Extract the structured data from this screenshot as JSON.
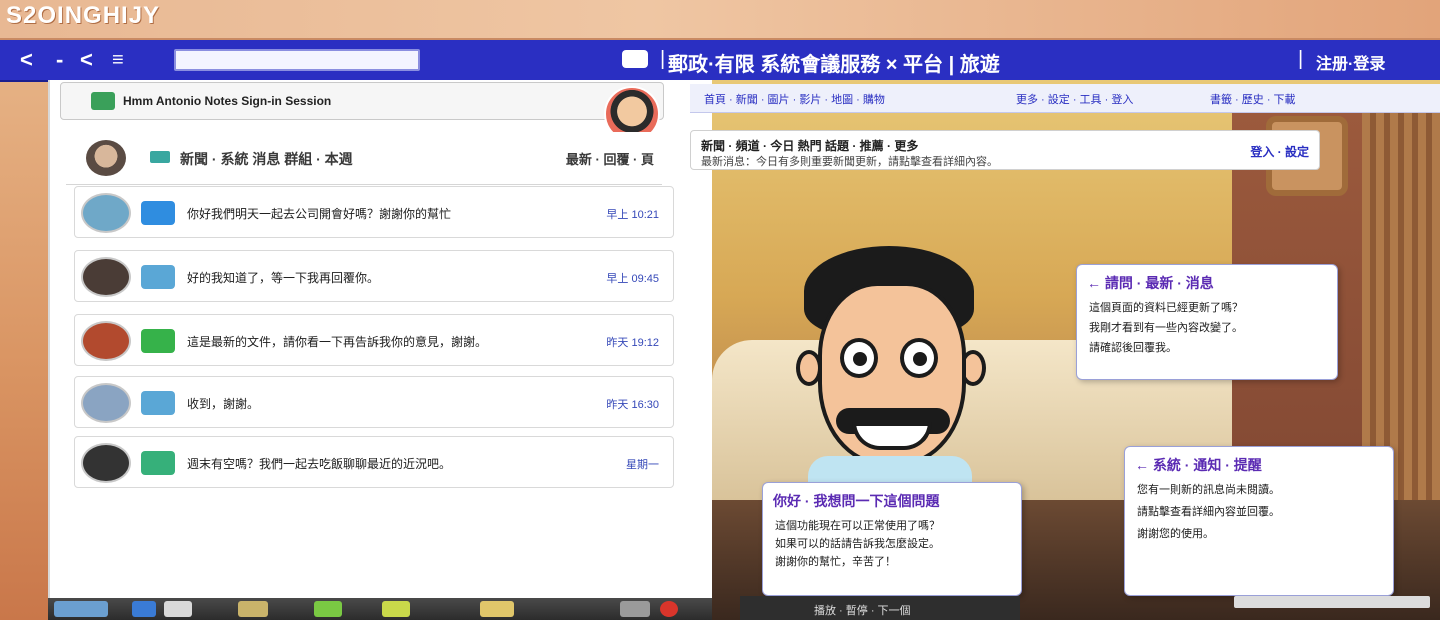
{
  "banner": {
    "logo": "S2OINGHIJY"
  },
  "appbar": {
    "back_glyph": "<",
    "dash_glyph": "-",
    "forward_glyph": "<",
    "menu_glyph": "≡",
    "address_value": "",
    "title": "郵政·有限 系統會議服務 × 平台 | 旅遊",
    "separator": "|",
    "user_label": "注册·登录"
  },
  "chat": {
    "header_title": "Hmm Antonio Notes Sign-in Session",
    "pinned": {
      "title": "新聞 · 系統 消息 群組 · 本週",
      "meta": "最新 · 回覆 · 頁"
    },
    "items": [
      {
        "message": "你好我們明天一起去公司開會好嗎？謝謝你的幫忙",
        "time": "早上 10:21",
        "avatar_color": "#6fa8c8",
        "icon_color": "#2f8de0"
      },
      {
        "message": "好的我知道了，等一下我再回覆你。",
        "time": "早上 09:45",
        "avatar_color": "#4a3c36",
        "icon_color": "#5aa7d6"
      },
      {
        "message": "這是最新的文件，請你看一下再告訴我你的意見，謝謝。",
        "time": "昨天 19:12",
        "avatar_color": "#b24a2e",
        "icon_color": "#36b24a"
      },
      {
        "message": "收到，謝謝。",
        "time": "昨天 16:30",
        "avatar_color": "#8aa4c2",
        "icon_color": "#5aa7d6"
      },
      {
        "message": "週末有空嗎？我們一起去吃飯聊聊最近的近況吧。",
        "time": "星期一",
        "avatar_color": "#333333",
        "icon_color": "#36b07a"
      }
    ]
  },
  "sub_toolbar": {
    "items": [
      "首頁 · 新聞 · 圖片 · 影片 · 地圖 · 購物",
      "更多 · 設定 · 工具 · 登入",
      "書籤 · 歷史 · 下載"
    ]
  },
  "info_banner": {
    "line1": "新聞 · 頻道 · 今日 熱門 話題 · 推薦 · 更多",
    "line2": "最新消息：今日有多則重要新聞更新，請點擊查看詳細內容。",
    "right": "登入 · 設定"
  },
  "speech_cards": [
    {
      "title": "你好 · 我想問一下這個問題",
      "lines": [
        "這個功能現在可以正常使用了嗎？",
        "如果可以的話請告訴我怎麼設定。",
        "謝謝你的幫忙，辛苦了！"
      ]
    },
    {
      "title": "← 請問 · 最新 · 消息",
      "lines": [
        "這個頁面的資料已經更新了嗎？",
        "我剛才看到有一些內容改變了。",
        "請確認後回覆我。"
      ]
    },
    {
      "title": "← 系統 · 通知 · 提醒",
      "lines": [
        "您有一則新的訊息尚未閱讀。",
        "請點擊查看詳細內容並回覆。",
        "謝謝您的使用。"
      ]
    }
  ],
  "bottom_strip": {
    "label": "播放 · 暫停 · 下一個"
  },
  "colors": {
    "appbar": "#2a2fc2",
    "accent_purple": "#5b2bb3",
    "time_blue": "#3548b8"
  },
  "icons": [
    "back-arrow-icon",
    "forward-arrow-icon",
    "menu-icon",
    "window-icon",
    "chat-app-icon",
    "avatar"
  ]
}
